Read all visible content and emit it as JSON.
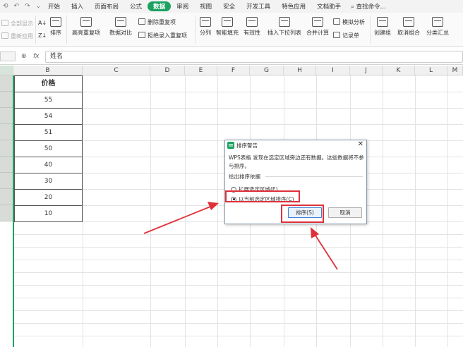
{
  "toolbar": {
    "quick": [
      "⟲",
      "↶",
      "↷",
      "⌄"
    ],
    "tabs": [
      "开始",
      "插入",
      "页面布局",
      "公式",
      "数据",
      "审阅",
      "视图",
      "安全",
      "开发工具",
      "特色应用",
      "文档助手"
    ],
    "active_tab": "数据",
    "search_label": "查找命令..."
  },
  "ribbon": {
    "show_all": "全部显示",
    "reapply": "重新应用",
    "sort": "排序",
    "highlight_dup": "高亮重复项",
    "data_compare": "数据对比",
    "delete_dup": "删除重复项",
    "reject_dup": "拒绝录入重复项",
    "split": "分列",
    "smart_fill": "智能填充",
    "validity": "有效性",
    "dropdown": "插入下拉列表",
    "merge_calc": "合并计算",
    "simulate": "模拟分析",
    "record_sheet": "记录单",
    "group": "创建组",
    "ungroup": "取消组合",
    "subtotal": "分类汇总"
  },
  "formula_bar": {
    "fx": "fx",
    "value": "姓名"
  },
  "sheet": {
    "columns": [
      "B",
      "C",
      "D",
      "E",
      "F",
      "G",
      "H",
      "I",
      "J",
      "K",
      "L",
      "M"
    ],
    "header": "价格",
    "values": [
      "55",
      "54",
      "51",
      "50",
      "40",
      "30",
      "20",
      "10"
    ]
  },
  "dialog": {
    "title": "排序警告",
    "message": "WPS表格 发现在选定区域旁边还有数据。这些数据将不参与排序。",
    "group_label": "给出排序依据",
    "option_expand": "扩展选定区域(E)",
    "option_current": "以当前选定区域排序(C)",
    "selected": "option_current",
    "sort_button": "排序(S)",
    "cancel_button": "取消",
    "close": "✕"
  },
  "colors": {
    "accent": "#1aa260",
    "annotation": "#e0303a"
  }
}
